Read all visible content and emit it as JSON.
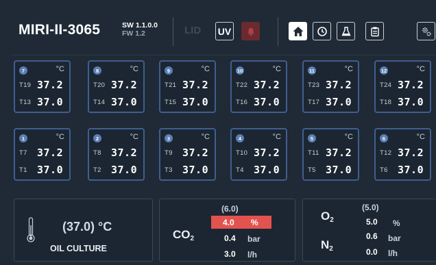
{
  "header": {
    "device_name": "MIRI-II-3065",
    "sw_version": "SW 1.1.0.0",
    "fw_version": "FW 1.2",
    "lid_label": "LID",
    "uv_label": "UV",
    "icons": [
      "alarm-bell-icon",
      "home-icon",
      "timer-icon",
      "flask-icon",
      "clipboard-icon",
      "settings-gear-icon"
    ]
  },
  "tiles": [
    {
      "num": "7",
      "unit": "°C",
      "r1_name": "T19",
      "r1_val": "37.2",
      "r2_name": "T13",
      "r2_val": "37.0"
    },
    {
      "num": "8",
      "unit": "°C",
      "r1_name": "T20",
      "r1_val": "37.2",
      "r2_name": "T14",
      "r2_val": "37.0"
    },
    {
      "num": "9",
      "unit": "°C",
      "r1_name": "T21",
      "r1_val": "37.2",
      "r2_name": "T15",
      "r2_val": "37.0"
    },
    {
      "num": "10",
      "unit": "°C",
      "r1_name": "T22",
      "r1_val": "37.2",
      "r2_name": "T16",
      "r2_val": "37.0"
    },
    {
      "num": "11",
      "unit": "°C",
      "r1_name": "T23",
      "r1_val": "37.2",
      "r2_name": "T17",
      "r2_val": "37.0"
    },
    {
      "num": "12",
      "unit": "°C",
      "r1_name": "T24",
      "r1_val": "37.2",
      "r2_name": "T18",
      "r2_val": "37.0"
    },
    {
      "num": "1",
      "unit": "°C",
      "r1_name": "T7",
      "r1_val": "37.2",
      "r2_name": "T1",
      "r2_val": "37.0"
    },
    {
      "num": "2",
      "unit": "°C",
      "r1_name": "T8",
      "r1_val": "37.2",
      "r2_name": "T2",
      "r2_val": "37.0"
    },
    {
      "num": "3",
      "unit": "°C",
      "r1_name": "T9",
      "r1_val": "37.2",
      "r2_name": "T3",
      "r2_val": "37.0"
    },
    {
      "num": "4",
      "unit": "°C",
      "r1_name": "T10",
      "r1_val": "37.2",
      "r2_name": "T4",
      "r2_val": "37.0"
    },
    {
      "num": "5",
      "unit": "°C",
      "r1_name": "T11",
      "r1_val": "37.2",
      "r2_name": "T5",
      "r2_val": "37.0"
    },
    {
      "num": "6",
      "unit": "°C",
      "r1_name": "T12",
      "r1_val": "37.2",
      "r2_name": "T6",
      "r2_val": "37.0"
    }
  ],
  "oil": {
    "value": "(37.0) °C",
    "label": "OIL CULTURE"
  },
  "co2": {
    "gas": "CO",
    "sub": "2",
    "setpoint": "(6.0)",
    "value": "4.0",
    "unit": "%",
    "pressure": "0.4",
    "pressure_unit": "bar",
    "flow": "3.0",
    "flow_unit": "l/h",
    "alert_color": "#e2534f"
  },
  "o2n2": {
    "o2_gas": "O",
    "o2_sub": "2",
    "n2_gas": "N",
    "n2_sub": "2",
    "setpoint": "(5.0)",
    "value": "5.0",
    "unit": "%",
    "pressure": "0.6",
    "pressure_unit": "bar",
    "flow": "0.0",
    "flow_unit": "l/h"
  }
}
